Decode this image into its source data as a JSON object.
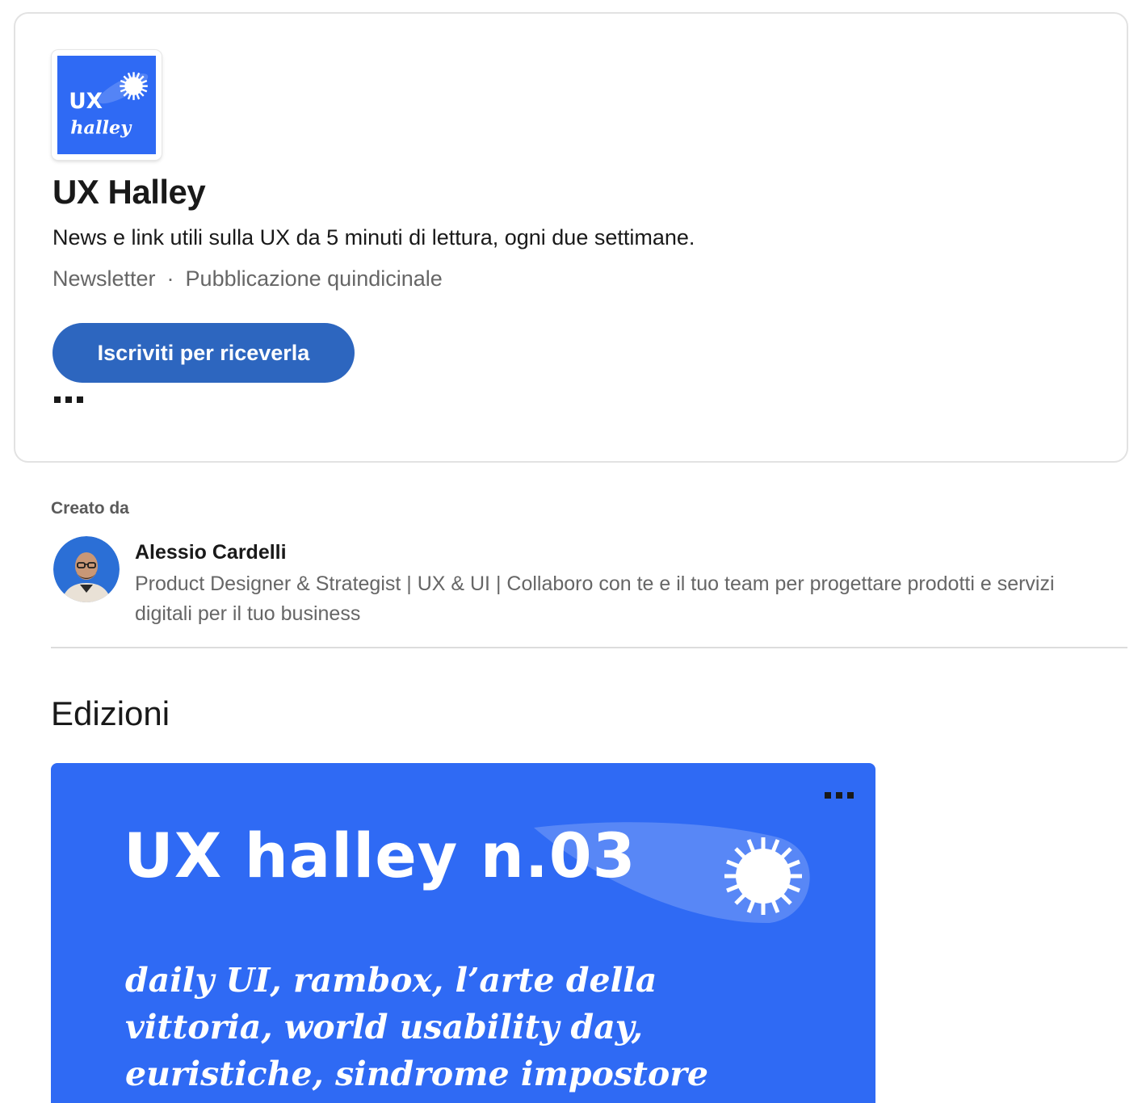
{
  "newsletter": {
    "logo_text_top": "UX",
    "logo_text_bottom": "halley",
    "title": "UX Halley",
    "description": "News e link utili sulla UX da 5 minuti di lettura, ogni due settimane.",
    "type": "Newsletter",
    "separator": "·",
    "frequency": "Pubblicazione quindicinale",
    "subscribe_label": "Iscriviti per riceverla",
    "more_icon": "more-horizontal-icon"
  },
  "creator": {
    "label": "Creato da",
    "name": "Alessio Cardelli",
    "headline": "Product Designer & Strategist | UX & UI | Collaboro con te e il tuo team per progettare prodotti e servizi digitali per il tuo business"
  },
  "editions": {
    "title": "Edizioni",
    "items": [
      {
        "heading": "UX halley n.03",
        "topics": "daily UI, rambox, l’arte della vittoria, world usability day, euristiche, sindrome impostore"
      }
    ]
  },
  "colors": {
    "accent": "#2d66bf",
    "logo_blue": "#2f6af4",
    "text_primary": "#191919",
    "text_secondary": "#666666"
  }
}
